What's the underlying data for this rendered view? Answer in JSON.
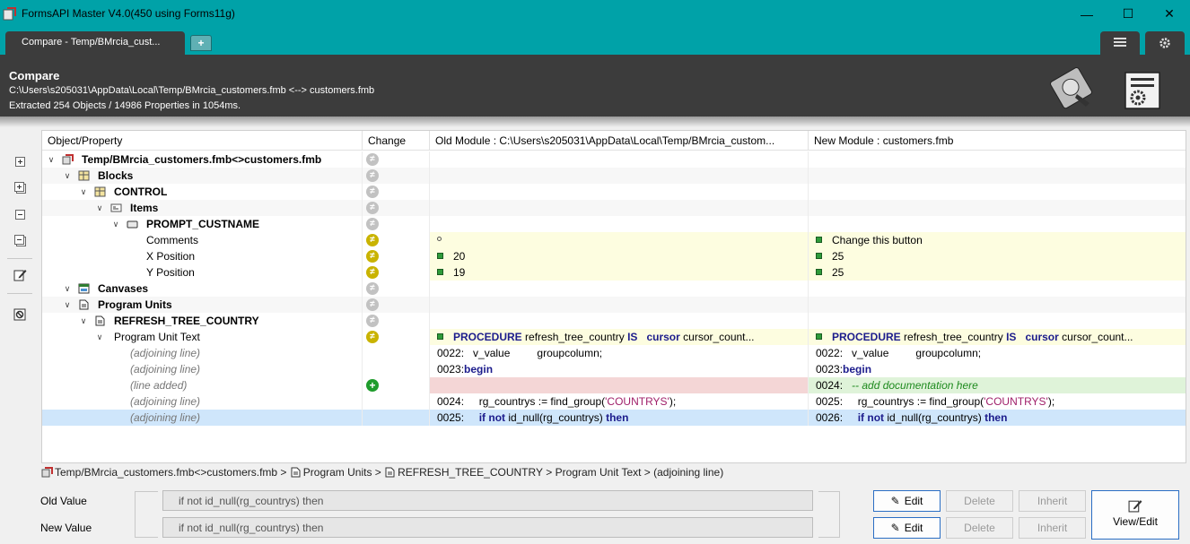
{
  "window": {
    "title": "FormsAPI Master V4.0(450 using Forms11g)",
    "controls": {
      "minimize": "—",
      "maximize": "☐",
      "close": "✕"
    }
  },
  "tabs": {
    "active_label": "Compare - Temp/BMrcia_cust...",
    "add_label": "+",
    "right_icons": [
      "list-icon",
      "gear-icon"
    ]
  },
  "header": {
    "title": "Compare",
    "path": "C:\\Users\\s205031\\AppData\\Local\\Temp/BMrcia_customers.fmb <--> customers.fmb",
    "stats": "Extracted 254 Objects / 14986 Properties in 1054ms."
  },
  "grid": {
    "columns": {
      "name": "Object/Property",
      "change": "Change",
      "old": "Old Module : C:\\Users\\s205031\\AppData\\Local\\Temp/BMrcia_custom...",
      "new": "New Module : customers.fmb"
    },
    "rows": {
      "r0": {
        "name": "Temp/BMrcia_customers.fmb<>customers.fmb"
      },
      "r1": {
        "name": "Blocks"
      },
      "r2": {
        "name": "CONTROL"
      },
      "r3": {
        "name": "Items"
      },
      "r4": {
        "name": "PROMPT_CUSTNAME"
      },
      "r5": {
        "name": "Comments",
        "old": "",
        "new": "Change this button"
      },
      "r6": {
        "name": "X Position",
        "old": "20",
        "new": "25"
      },
      "r7": {
        "name": "Y Position",
        "old": "19",
        "new": "25"
      },
      "r8": {
        "name": "Canvases"
      },
      "r9": {
        "name": "Program Units"
      },
      "r10": {
        "name": "REFRESH_TREE_COUNTRY"
      },
      "r11": {
        "name": "Program Unit Text",
        "old_kw1": "PROCEDURE",
        "old_t1": " refresh_tree_country ",
        "old_kw2": "IS",
        "old_t2": "   ",
        "old_kw3": "cursor",
        "old_t3": " cursor_count...",
        "new_kw1": "PROCEDURE",
        "new_t1": " refresh_tree_country ",
        "new_kw2": "IS",
        "new_t2": "   ",
        "new_kw3": "cursor",
        "new_t3": " cursor_count..."
      },
      "r12": {
        "name": "(adjoining line)",
        "old": "0022:   v_value         groupcolumn;",
        "new": "0022:   v_value         groupcolumn;"
      },
      "r13": {
        "name": "(adjoining line)",
        "old_ln": "0023:",
        "old_kw": "begin",
        "new_ln": "0023:",
        "new_kw": "begin"
      },
      "r14": {
        "name": "(line added)",
        "new_ln": "0024:   ",
        "new_cmt": "-- add documentation here"
      },
      "r15": {
        "name": "(adjoining line)",
        "old_ln": "0024:     rg_countrys := find_group(",
        "old_str": "'COUNTRYS'",
        "old_end": ");",
        "new_ln": "0025:     rg_countrys := find_group(",
        "new_str": "'COUNTRYS'",
        "new_end": ");"
      },
      "r16": {
        "name": "(adjoining line)",
        "old_ln": "0025:     ",
        "old_kw1": "if not",
        "old_t": " id_null(rg_countrys) ",
        "old_kw2": "then",
        "new_ln": "0026:     ",
        "new_kw1": "if not",
        "new_t": " id_null(rg_countrys) ",
        "new_kw2": "then"
      }
    }
  },
  "breadcrumb": {
    "p1": "Temp/BMrcia_customers.fmb<>customers.fmb",
    "sep": " > ",
    "p2": "Program Units",
    "p3": "REFRESH_TREE_COUNTRY",
    "p4": "Program Unit Text",
    "p5": "(adjoining line)"
  },
  "bottom": {
    "old_label": "Old Value",
    "new_label": "New Value",
    "old_value": "if not id_null(rg_countrys) then",
    "new_value": "if not id_null(rg_countrys) then",
    "edit_label": "Edit",
    "delete_label": "Delete",
    "inherit_label": "Inherit",
    "view_edit_label": "View/Edit"
  },
  "colors": {
    "titlebar": "#00a2a8",
    "header": "#3c3c3c",
    "changed_row": "#fdfde0",
    "added_old": "#f4d6d6",
    "added_new": "#dff3d9",
    "selected_row": "#cfe6fb"
  }
}
